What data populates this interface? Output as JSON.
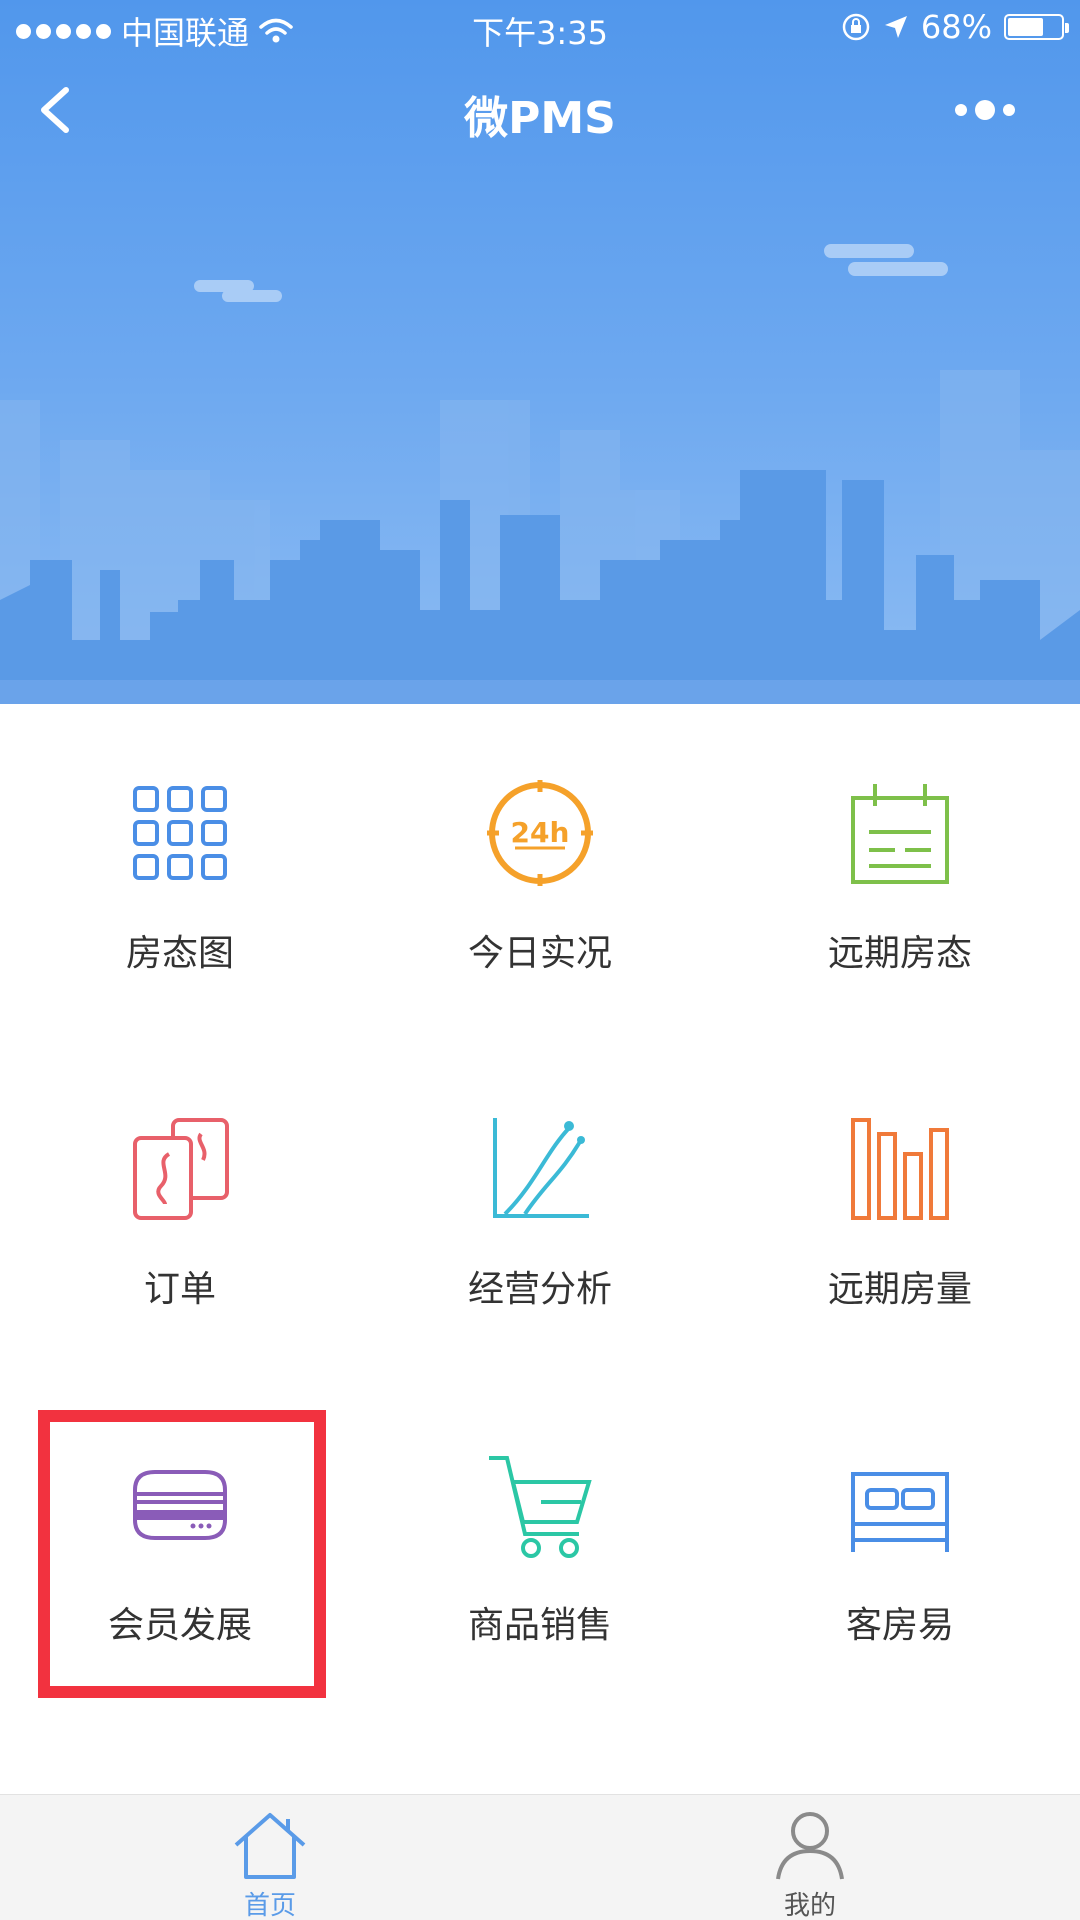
{
  "status_bar": {
    "carrier": "中国联通",
    "time": "下午3:35",
    "battery": "68%",
    "battery_level": 0.68
  },
  "navbar": {
    "title": "微PMS"
  },
  "colors": {
    "header_blue": "#5197ec",
    "highlight_red": "#f2323f",
    "tab_active": "#5a9be8",
    "tab_inactive": "#888888"
  },
  "menu": [
    {
      "label": "房态图",
      "icon": "room-grid-icon"
    },
    {
      "label": "今日实况",
      "icon": "clock-24h-icon"
    },
    {
      "label": "远期房态",
      "icon": "calendar-icon"
    },
    {
      "label": "订单",
      "icon": "order-cards-icon"
    },
    {
      "label": "经营分析",
      "icon": "analytics-chart-icon"
    },
    {
      "label": "远期房量",
      "icon": "bar-chart-icon"
    },
    {
      "label": "会员发展",
      "icon": "member-card-icon"
    },
    {
      "label": "商品销售",
      "icon": "shopping-cart-icon"
    },
    {
      "label": "客房易",
      "icon": "bed-icon"
    }
  ],
  "tabbar": {
    "home": "首页",
    "mine": "我的"
  }
}
